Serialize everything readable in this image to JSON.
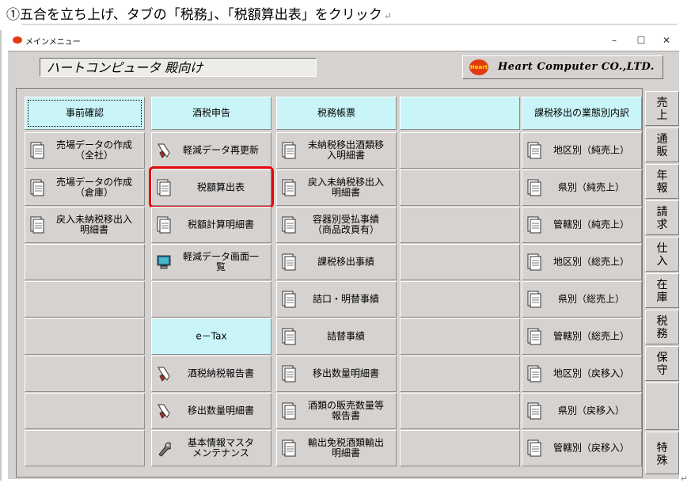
{
  "instruction": {
    "text": "①五合を立ち上げ、タブの「税務」、「税額算出表」をクリック",
    "mark": "↵"
  },
  "window": {
    "title": "メインメニュー",
    "min": "–",
    "max": "☐",
    "close": "✕"
  },
  "banner": {
    "text": "ハートコンピュータ 殿向け"
  },
  "company": {
    "badge": "Heart",
    "name": "Heart Computer CO.,LTD."
  },
  "columns": [
    {
      "header": "事前確認",
      "cells": [
        {
          "label": "売場データの作成\n（全社）",
          "icon": "document-icon"
        },
        {
          "label": "売場データの作成\n（倉庫）",
          "icon": "document-icon"
        },
        {
          "label": "戻入未納税移出入\n明細書",
          "icon": "document-icon"
        },
        {
          "label": "",
          "icon": ""
        },
        {
          "label": "",
          "icon": ""
        },
        {
          "label": "",
          "icon": ""
        },
        {
          "label": "",
          "icon": ""
        },
        {
          "label": "",
          "icon": ""
        },
        {
          "label": "",
          "icon": ""
        }
      ]
    },
    {
      "header": "酒税申告",
      "cells": [
        {
          "label": "軽減データ再更新",
          "icon": "pen-icon"
        },
        {
          "label": "税額算出表",
          "icon": "document-icon"
        },
        {
          "label": "税額計算明細書",
          "icon": "document-icon"
        },
        {
          "label": "軽減データ画面一\n覧",
          "icon": "monitor-icon"
        },
        {
          "label": "",
          "icon": ""
        },
        {
          "label": "e－Tax",
          "icon": "",
          "head": true
        },
        {
          "label": "酒税納税報告書",
          "icon": "pen-icon"
        },
        {
          "label": "移出数量明細書",
          "icon": "pen-icon"
        },
        {
          "label": "基本情報マスタ\nメンテナンス",
          "icon": "wrench-icon"
        }
      ]
    },
    {
      "header": "税務帳票",
      "cells": [
        {
          "label": "未納税移出酒類移\n入明細書",
          "icon": "document-icon"
        },
        {
          "label": "戻入未納税移出入\n明細書",
          "icon": "document-icon"
        },
        {
          "label": "容器別受払事績\n（商品改頁有）",
          "icon": "document-icon"
        },
        {
          "label": "課税移出事績",
          "icon": "document-icon"
        },
        {
          "label": "詰口・明替事績",
          "icon": "document-icon"
        },
        {
          "label": "詰替事績",
          "icon": "document-icon"
        },
        {
          "label": "移出数量明細書",
          "icon": "document-icon"
        },
        {
          "label": "酒類の販売数量等\n報告書",
          "icon": "document-icon"
        },
        {
          "label": "輸出免税酒類輸出\n明細書",
          "icon": "document-icon"
        }
      ]
    },
    {
      "header": "",
      "cells": [
        {
          "label": "",
          "icon": ""
        },
        {
          "label": "",
          "icon": ""
        },
        {
          "label": "",
          "icon": ""
        },
        {
          "label": "",
          "icon": ""
        },
        {
          "label": "",
          "icon": ""
        },
        {
          "label": "",
          "icon": ""
        },
        {
          "label": "",
          "icon": ""
        },
        {
          "label": "",
          "icon": ""
        },
        {
          "label": "",
          "icon": ""
        }
      ]
    },
    {
      "header": "課税移出の業態別内訳",
      "cells": [
        {
          "label": "地区別（純売上）",
          "icon": "document-icon"
        },
        {
          "label": "県別（純売上）",
          "icon": "document-icon"
        },
        {
          "label": "管轄別（純売上）",
          "icon": "document-icon"
        },
        {
          "label": "地区別（総売上）",
          "icon": "document-icon"
        },
        {
          "label": "県別（総売上）",
          "icon": "document-icon"
        },
        {
          "label": "管轄別（総売上）",
          "icon": "document-icon"
        },
        {
          "label": "地区別（戻移入）",
          "icon": "document-icon"
        },
        {
          "label": "県別（戻移入）",
          "icon": "document-icon"
        },
        {
          "label": "管轄別（戻移入）",
          "icon": "document-icon"
        }
      ]
    }
  ],
  "side_tabs": [
    "売\n上",
    "通\n販",
    "年\n報",
    "請\n求",
    "仕\n入",
    "在\n庫",
    "税\n務",
    "保\n守",
    "",
    "特\n殊"
  ],
  "highlight": {
    "color": "#e8070b",
    "cell": "税額算出表",
    "tab": "税務"
  },
  "tail_mark": "↵"
}
